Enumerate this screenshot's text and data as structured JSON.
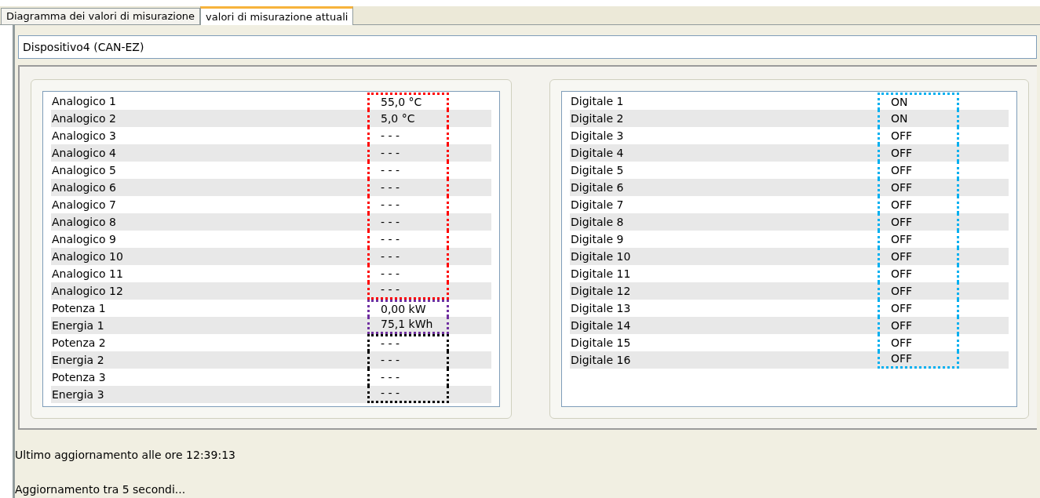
{
  "tabs": [
    {
      "label": "Diagramma dei valori di misurazione",
      "selected": false
    },
    {
      "label": "valori di misurazione attuali",
      "selected": true
    }
  ],
  "device": {
    "value": "Dispositivo4 (CAN-EZ)"
  },
  "analog_list": [
    {
      "name": "Analogico 1",
      "value": "55,0 °C",
      "color": "#ff0000"
    },
    {
      "name": "Analogico 2",
      "value": "5,0 °C",
      "color": "#ff0000"
    },
    {
      "name": "Analogico 3",
      "value": "- - -",
      "color": "#ff0000"
    },
    {
      "name": "Analogico 4",
      "value": "- - -",
      "color": "#ff0000"
    },
    {
      "name": "Analogico 5",
      "value": "- - -",
      "color": "#ff0000"
    },
    {
      "name": "Analogico 6",
      "value": "- - -",
      "color": "#ff0000"
    },
    {
      "name": "Analogico 7",
      "value": "- - -",
      "color": "#ff0000"
    },
    {
      "name": "Analogico 8",
      "value": "- - -",
      "color": "#ff0000"
    },
    {
      "name": "Analogico 9",
      "value": "- - -",
      "color": "#ff0000"
    },
    {
      "name": "Analogico 10",
      "value": "- - -",
      "color": "#ff0000"
    },
    {
      "name": "Analogico 11",
      "value": "- - -",
      "color": "#ff0000"
    },
    {
      "name": "Analogico 12",
      "value": "- - -",
      "color": "#ff0000"
    },
    {
      "name": "Potenza 1",
      "value": "0,00 kW",
      "color": "#7030a0"
    },
    {
      "name": "Energia 1",
      "value": "75,1 kWh",
      "color": "#7030a0"
    },
    {
      "name": "Potenza 2",
      "value": "- - -",
      "color": "#000000"
    },
    {
      "name": "Energia 2",
      "value": "- - -",
      "color": "#000000"
    },
    {
      "name": "Potenza 3",
      "value": "- - -",
      "color": "#000000"
    },
    {
      "name": "Energia 3",
      "value": "- - -",
      "color": "#000000"
    }
  ],
  "digital_list": [
    {
      "name": "Digitale 1",
      "value": "ON",
      "color": "#00b0f0"
    },
    {
      "name": "Digitale 2",
      "value": "ON",
      "color": "#00b0f0"
    },
    {
      "name": "Digitale 3",
      "value": "OFF",
      "color": "#00b0f0"
    },
    {
      "name": "Digitale 4",
      "value": "OFF",
      "color": "#00b0f0"
    },
    {
      "name": "Digitale 5",
      "value": "OFF",
      "color": "#00b0f0"
    },
    {
      "name": "Digitale 6",
      "value": "OFF",
      "color": "#00b0f0"
    },
    {
      "name": "Digitale 7",
      "value": "OFF",
      "color": "#00b0f0"
    },
    {
      "name": "Digitale 8",
      "value": "OFF",
      "color": "#00b0f0"
    },
    {
      "name": "Digitale 9",
      "value": "OFF",
      "color": "#00b0f0"
    },
    {
      "name": "Digitale 10",
      "value": "OFF",
      "color": "#00b0f0"
    },
    {
      "name": "Digitale 11",
      "value": "OFF",
      "color": "#00b0f0"
    },
    {
      "name": "Digitale 12",
      "value": "OFF",
      "color": "#00b0f0"
    },
    {
      "name": "Digitale 13",
      "value": "OFF",
      "color": "#00b0f0"
    },
    {
      "name": "Digitale 14",
      "value": "OFF",
      "color": "#00b0f0"
    },
    {
      "name": "Digitale 15",
      "value": "OFF",
      "color": "#00b0f0"
    },
    {
      "name": "Digitale 16",
      "value": "OFF",
      "color": "#00b0f0"
    }
  ],
  "status": {
    "last_update": "Ultimo aggiornamento alle ore 12:39:13",
    "next_update": "Aggiornamento tra 5 secondi..."
  }
}
